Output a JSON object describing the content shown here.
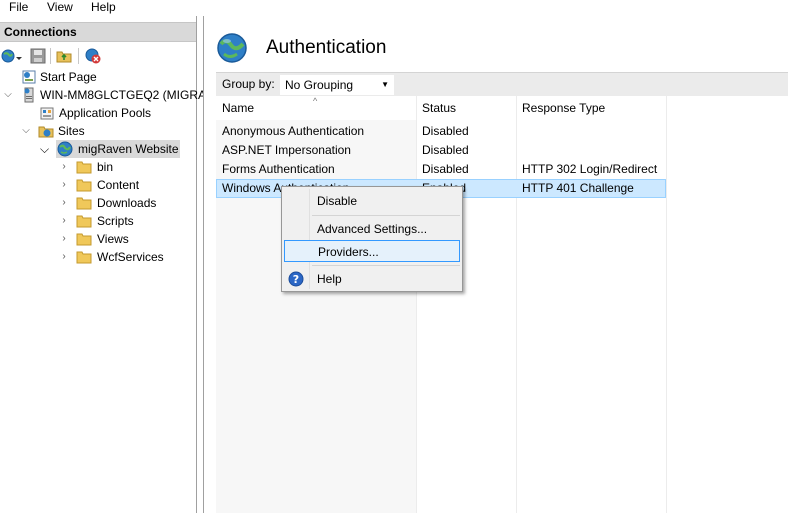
{
  "menubar": {
    "items": [
      "File",
      "View",
      "Help"
    ]
  },
  "connections": {
    "header": "Connections",
    "toolbar_icons": [
      "globe-connect-icon",
      "save-icon",
      "up-folder-icon",
      "disconnect-icon"
    ],
    "tree": [
      {
        "label": "Start Page",
        "icon": "start-page-icon"
      },
      {
        "label": "WIN-MM8GLCTGEQ2 (MIGRA",
        "icon": "server-icon"
      },
      {
        "label": "Application Pools",
        "icon": "app-pools-icon"
      },
      {
        "label": "Sites",
        "icon": "sites-folder-icon"
      },
      {
        "label": "migRaven Website",
        "icon": "globe-icon"
      },
      {
        "label": "bin",
        "icon": "folder-icon"
      },
      {
        "label": "Content",
        "icon": "folder-icon"
      },
      {
        "label": "Downloads",
        "icon": "folder-icon"
      },
      {
        "label": "Scripts",
        "icon": "folder-icon"
      },
      {
        "label": "Views",
        "icon": "folder-icon"
      },
      {
        "label": "WcfServices",
        "icon": "folder-icon"
      }
    ]
  },
  "main": {
    "title": "Authentication",
    "group_by_label": "Group by:",
    "group_by_value": "No Grouping",
    "columns": [
      "Name",
      "Status",
      "Response Type"
    ],
    "rows": [
      {
        "name": "Anonymous Authentication",
        "status": "Disabled",
        "response": ""
      },
      {
        "name": "ASP.NET Impersonation",
        "status": "Disabled",
        "response": ""
      },
      {
        "name": "Forms Authentication",
        "status": "Disabled",
        "response": "HTTP 302 Login/Redirect"
      },
      {
        "name": "Windows Authentication",
        "status": "Enabled",
        "response": "HTTP 401 Challenge"
      }
    ]
  },
  "context_menu": {
    "items": [
      "Disable",
      "Advanced Settings...",
      "Providers...",
      "Help"
    ],
    "highlighted": "Providers..."
  },
  "colors": {
    "selection": "#cce8ff",
    "selection_border": "#99d1ff",
    "menu_highlight": "#e5f1fb"
  }
}
